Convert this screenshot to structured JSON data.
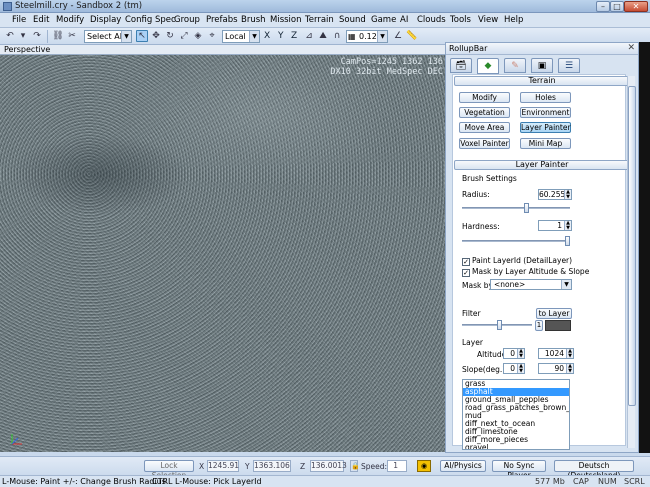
{
  "window": {
    "title": "Steelmill.cry - Sandbox 2 (tm)",
    "min": "–",
    "max": "□",
    "close": "✕"
  },
  "menu": [
    "File",
    "Edit",
    "Modify",
    "Display",
    "Config Spec",
    "Group",
    "Prefabs",
    "Brush",
    "Mission",
    "Terrain",
    "Sound",
    "Game",
    "AI",
    "Clouds",
    "Tools",
    "View",
    "Help"
  ],
  "toolbar": {
    "selection": "Select All",
    "coord_system": "Local",
    "axes": [
      "X",
      "Y",
      "Z"
    ],
    "grid_value": "0.125"
  },
  "viewport": {
    "label": "Perspective",
    "campos": "CamPos=1245 1362 136",
    "renderer": "DX10 32bit MedSpec DEC"
  },
  "rollup": {
    "title": "RollupBar",
    "close": "✕",
    "terrain_header": "Terrain",
    "terrain_buttons": [
      "Modify",
      "Holes",
      "Vegetation",
      "Environment",
      "Move Area",
      "Layer Painter",
      "Voxel Painter",
      "Mini Map"
    ],
    "layer_painter_header": "Layer Painter",
    "brush_settings": "Brush Settings",
    "radius_label": "Radius:",
    "radius_value": "60.255",
    "radius_level": 0.6,
    "hardness_label": "Hardness:",
    "hardness_value": "1",
    "hardness_level": 1.0,
    "paint_layerid": "Paint LayerId (DetailLayer)",
    "mask_altitude": "Mask by Layer Altitude & Slope",
    "mask_by_label": "Mask by",
    "mask_by_value": "<none>",
    "filter_label": "Filter",
    "to_layer": "to Layer",
    "filter_value": "1",
    "layer_label": "Layer",
    "altitude_label": "Altitude",
    "altitude_min": "0",
    "altitude_max": "1024",
    "slope_label": "Slope(deg.)",
    "slope_min": "0",
    "slope_max": "90",
    "layers": [
      "grass",
      "asphalt",
      "ground_small_pepples",
      "road_grass_patches_brown_soil",
      "mud",
      "diff_next_to_ocean",
      "diff_limestone",
      "diff_more_pieces",
      "gravel"
    ],
    "selected_layer": "asphalt"
  },
  "status1": {
    "lock_selection": "Lock Selection",
    "x_label": "X",
    "x": "1245.91",
    "y_label": "Y",
    "y": "1363.106",
    "z_label": "Z",
    "z": "136.0013",
    "speed_label": "Speed:",
    "speed": "1",
    "ai_physics": "AI/Physics",
    "no_sync": "No Sync Player",
    "locale": "Deutsch (Deutschland)"
  },
  "status2": {
    "hint1": "L-Mouse: Paint  +/-: Change Brush Radius",
    "hint2": "CTRL L-Mouse: Pick LayerId",
    "memory": "577 Mb",
    "caps": "CAP",
    "num": "NUM",
    "scrl": "SCRL"
  }
}
